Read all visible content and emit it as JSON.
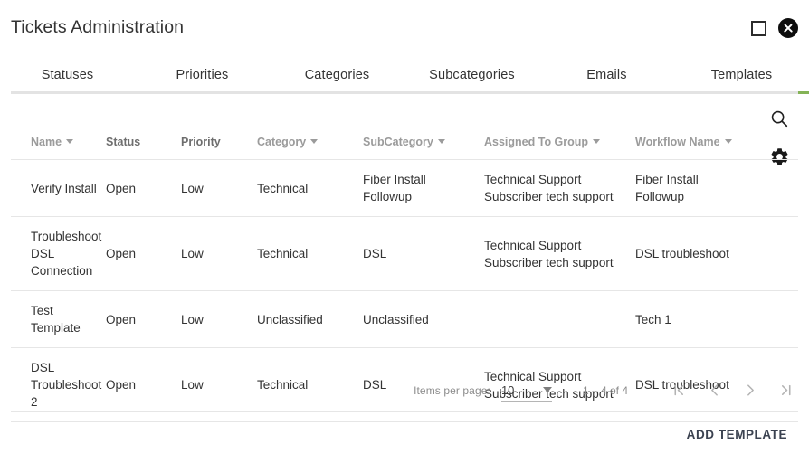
{
  "window": {
    "title": "Tickets Administration",
    "maximize_label": "Maximize",
    "close_label": "Close"
  },
  "tabs": [
    {
      "label": "Statuses",
      "active": false
    },
    {
      "label": "Priorities",
      "active": false
    },
    {
      "label": "Categories",
      "active": false
    },
    {
      "label": "Subcategories",
      "active": false
    },
    {
      "label": "Emails",
      "active": false
    },
    {
      "label": "Templates",
      "active": true
    }
  ],
  "toolbar": {
    "search_icon": "search-icon",
    "settings_icon": "gear-icon"
  },
  "table": {
    "columns": [
      {
        "label": "Name",
        "sortable": true,
        "style": "muted"
      },
      {
        "label": "Status",
        "sortable": false,
        "style": "plain"
      },
      {
        "label": "Priority",
        "sortable": false,
        "style": "plain"
      },
      {
        "label": "Category",
        "sortable": true,
        "style": "muted"
      },
      {
        "label": "SubCategory",
        "sortable": true,
        "style": "muted"
      },
      {
        "label": "Assigned To Group",
        "sortable": true,
        "style": "muted"
      },
      {
        "label": "Workflow Name",
        "sortable": true,
        "style": "muted"
      }
    ],
    "rows": [
      {
        "name": "Verify Install",
        "status": "Open",
        "priority": "Low",
        "category": "Technical",
        "subcategory": "Fiber Install Followup",
        "assigned_to_group": "Technical Support Subscriber tech support",
        "workflow_name": "Fiber Install Followup"
      },
      {
        "name": "Troubleshoot DSL Connection",
        "status": "Open",
        "priority": "Low",
        "category": "Technical",
        "subcategory": "DSL",
        "assigned_to_group": "Technical Support Subscriber tech support",
        "workflow_name": "DSL troubleshoot"
      },
      {
        "name": "Test Template",
        "status": "Open",
        "priority": "Low",
        "category": "Unclassified",
        "subcategory": "Unclassified",
        "assigned_to_group": "",
        "workflow_name": "Tech 1"
      },
      {
        "name": "DSL Troubleshoot 2",
        "status": "Open",
        "priority": "Low",
        "category": "Technical",
        "subcategory": "DSL",
        "assigned_to_group": "Technical Support Subscriber tech support",
        "workflow_name": "DSL troubleshoot"
      }
    ]
  },
  "paginator": {
    "items_per_page_label": "Items per page:",
    "items_per_page_value": "10",
    "range_label": "1 – 4 of 4",
    "first_page_label": "First page",
    "previous_page_label": "Previous page",
    "next_page_label": "Next page",
    "last_page_label": "Last page"
  },
  "footer": {
    "add_template_label": "ADD TEMPLATE"
  },
  "colors": {
    "accent_green": "#84b356",
    "text": "#333333",
    "muted": "#9b9b9b",
    "divider": "#e6e6e6",
    "footer_button": "#3b4250"
  }
}
